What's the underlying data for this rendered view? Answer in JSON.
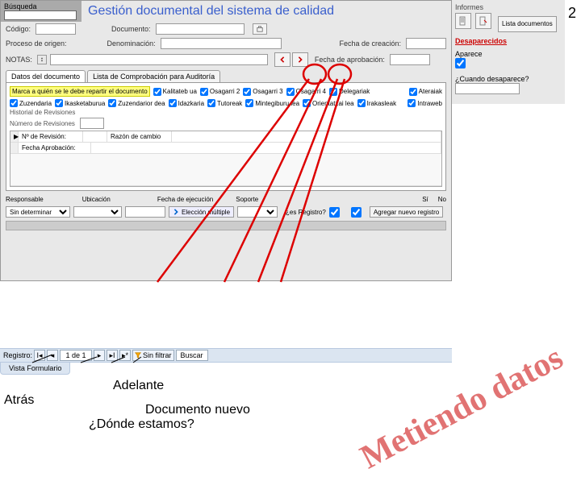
{
  "page_number": "2",
  "window": {
    "search_label": "Búsqueda",
    "title": "Gestión documental del sistema de calidad",
    "row1": {
      "codigo": "Código:",
      "documento": "Documento:"
    },
    "row2": {
      "proceso": "Proceso de origen:",
      "denominacion": "Denominación:",
      "fecha_creacion": "Fecha de creación:"
    },
    "row3": {
      "notas": "NOTAS:",
      "fecha_aprobacion": "Fecha de aprobación:"
    },
    "tabs": {
      "datos": "Datos del documento",
      "lista": "Lista de Comprobación para Auditoría"
    },
    "mark_text": "Marca a quién se le debe repartir el documento",
    "checks_top": [
      "Kalitateb ua",
      "Osagarri 2",
      "Osagarri 3",
      "Osagarri 4",
      "Delegariak",
      "Ateraiak"
    ],
    "checks_bot": [
      "Zuzendaria",
      "Ikasketaburua",
      "Zuzendarior dea",
      "Idazkaria",
      "Tutoreak",
      "Mintegiburu lea",
      "Orientatzai lea",
      "Irakasleak",
      "Intraweb"
    ],
    "historial": "Historial de Revisiones",
    "numero_rev": "Número de Revisiones",
    "rev_fields": {
      "num": "Nº de Revisión:",
      "razon": "Razón de cambio",
      "fecha": "Fecha Aprobación:"
    },
    "bottom": {
      "responsable": "Responsable",
      "ubicacion": "Ubicación",
      "fecha_ejec": "Fecha de ejecución",
      "soporte": "Soporte",
      "si": "Sí",
      "no": "No",
      "sin_determinar": "Sin determinar",
      "eleccion": "Elección múltiple",
      "es_registro": "¿es Registro?",
      "agregar": "Agregar nuevo registro"
    }
  },
  "right": {
    "informes": "Informes",
    "lista_docs": "Lista documentos",
    "desaparecidos": "Desaparecidos",
    "aparece": "Aparece",
    "cuando": "¿Cuando desaparece?"
  },
  "navbar": {
    "registro": "Registro:",
    "counter": "1 de 1",
    "sin_filtrar": "Sin filtrar",
    "buscar": "Buscar"
  },
  "view_tab": "Vista Formulario",
  "annotations": {
    "atras": "Atrás",
    "adelante": "Adelante",
    "doc_nuevo": "Documento nuevo",
    "donde": "¿Dónde estamos?"
  },
  "watermark": "Metiendo datos"
}
